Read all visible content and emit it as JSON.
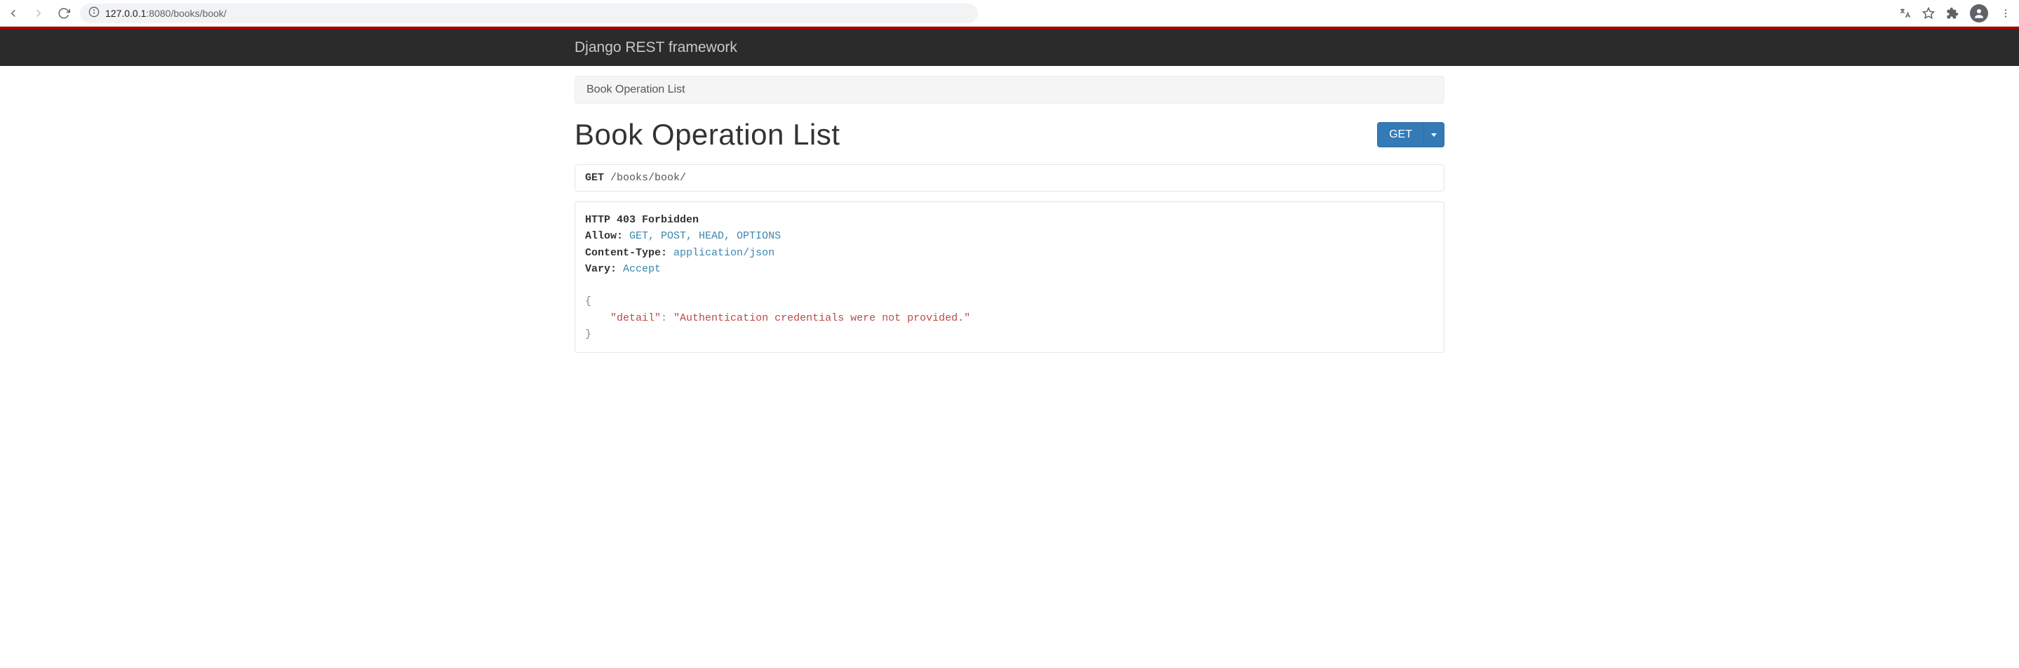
{
  "browser": {
    "url_host": "127.0.0.1",
    "url_port": ":8080",
    "url_path": "/books/book/"
  },
  "navbar": {
    "brand": "Django REST framework"
  },
  "breadcrumb": {
    "item": "Book Operation List"
  },
  "page": {
    "title": "Book Operation List"
  },
  "actions": {
    "get_label": "GET"
  },
  "request": {
    "method": "GET",
    "path": "/books/book/"
  },
  "response": {
    "status": "HTTP 403 Forbidden",
    "headers": [
      {
        "name": "Allow:",
        "value": "GET, POST, HEAD, OPTIONS"
      },
      {
        "name": "Content-Type:",
        "value": "application/json"
      },
      {
        "name": "Vary:",
        "value": "Accept"
      }
    ],
    "body_open": "{",
    "body_key": "\"detail\"",
    "body_colon": ": ",
    "body_value": "\"Authentication credentials were not provided.\"",
    "body_close": "}"
  }
}
